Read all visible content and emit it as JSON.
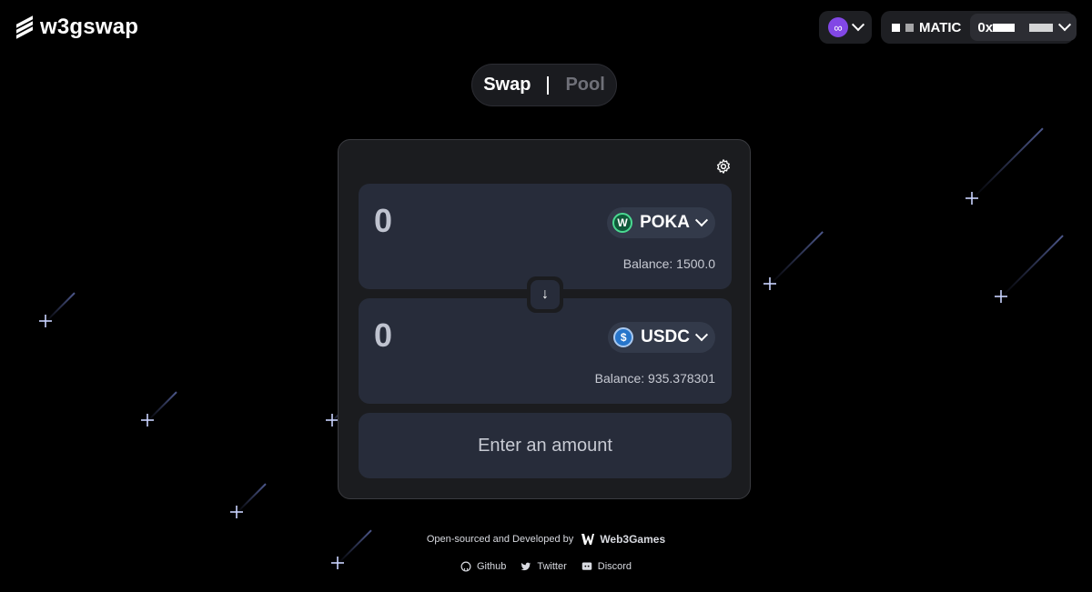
{
  "app": {
    "name": "w3gswap"
  },
  "header": {
    "network": {
      "currency": "MATIC",
      "accent": "#8247e5"
    },
    "wallet": {
      "address_prefix": "0x"
    }
  },
  "tabs": [
    {
      "label": "Swap"
    },
    {
      "label": "Pool"
    }
  ],
  "swap": {
    "from": {
      "amount": "0",
      "token": "POKA",
      "balance": "Balance: 1500.0"
    },
    "to": {
      "amount": "0",
      "token": "USDC",
      "balance": "Balance: 935.378301"
    },
    "cta": "Enter an amount"
  },
  "footer": {
    "credit": "Open-sourced and Developed by",
    "brand": "Web3Games",
    "links": [
      {
        "label": "Github"
      },
      {
        "label": "Twitter"
      },
      {
        "label": "Discord"
      }
    ]
  },
  "colors": {
    "background": "#000000",
    "card": "#1b1c1f",
    "panel": "#272c3a"
  }
}
